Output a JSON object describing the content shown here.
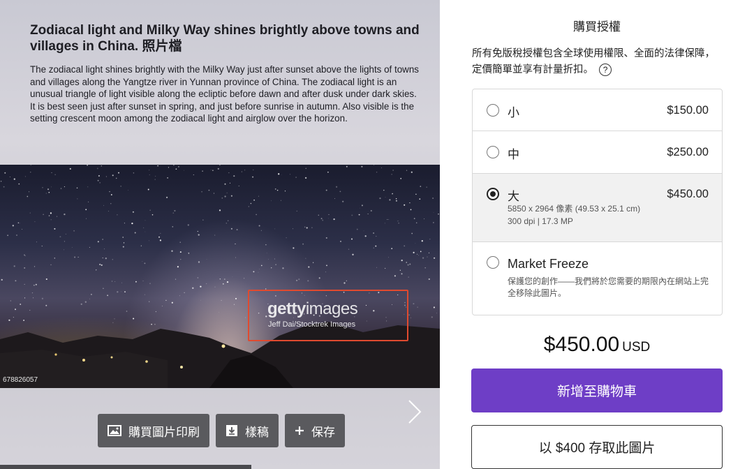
{
  "left": {
    "title": "Zodiacal light and Milky Way shines brightly above towns and villages in China. 照片檔",
    "description": "The zodiacal light shines brightly with the Milky Way just after sunset above the lights of towns and villages along the Yangtze river in Yunnan province of China. The zodiacal light is an unusual triangle of light visible along the ecliptic before dawn and after dusk under dark skies. It is best seen just after sunset in spring, and just before sunrise in autumn. Also visible is the setting crescent moon among the zodiacal light and airglow over the horizon.",
    "image_id": "678826057",
    "watermark": {
      "logo_bold": "getty",
      "logo_rest": "images",
      "credit": "Jeff Dai/Stocktrek Images",
      "highlight_color": "#e04a2f"
    },
    "buttons": [
      {
        "label": "購買圖片印刷",
        "icon": "image-icon"
      },
      {
        "label": "樣稿",
        "icon": "download-icon"
      },
      {
        "label": "保存",
        "icon": "plus-icon"
      }
    ]
  },
  "right": {
    "heading": "購買授權",
    "info": "所有免版稅授權包含全球使用權限、全面的法律保障，定價簡單並享有計量折扣。",
    "options": [
      {
        "name": "小",
        "price": "$150.00",
        "selected": false
      },
      {
        "name": "中",
        "price": "$250.00",
        "selected": false
      },
      {
        "name": "大",
        "price": "$450.00",
        "selected": true,
        "detail1": "5850 x 2964 像素 (49.53 x 25.1 cm)",
        "detail2": "300 dpi | 17.3 MP"
      },
      {
        "name": "Market Freeze",
        "price": "",
        "selected": false,
        "detail1": "保護您的創作——我們將於您需要的期限內在網站上完全移除此圖片。"
      }
    ],
    "total_amount": "$450.00",
    "total_currency": "USD",
    "add_to_cart": "新增至購物車",
    "save_offer": "以 $400 存取此圖片",
    "accent_color": "#6e3ec6"
  }
}
